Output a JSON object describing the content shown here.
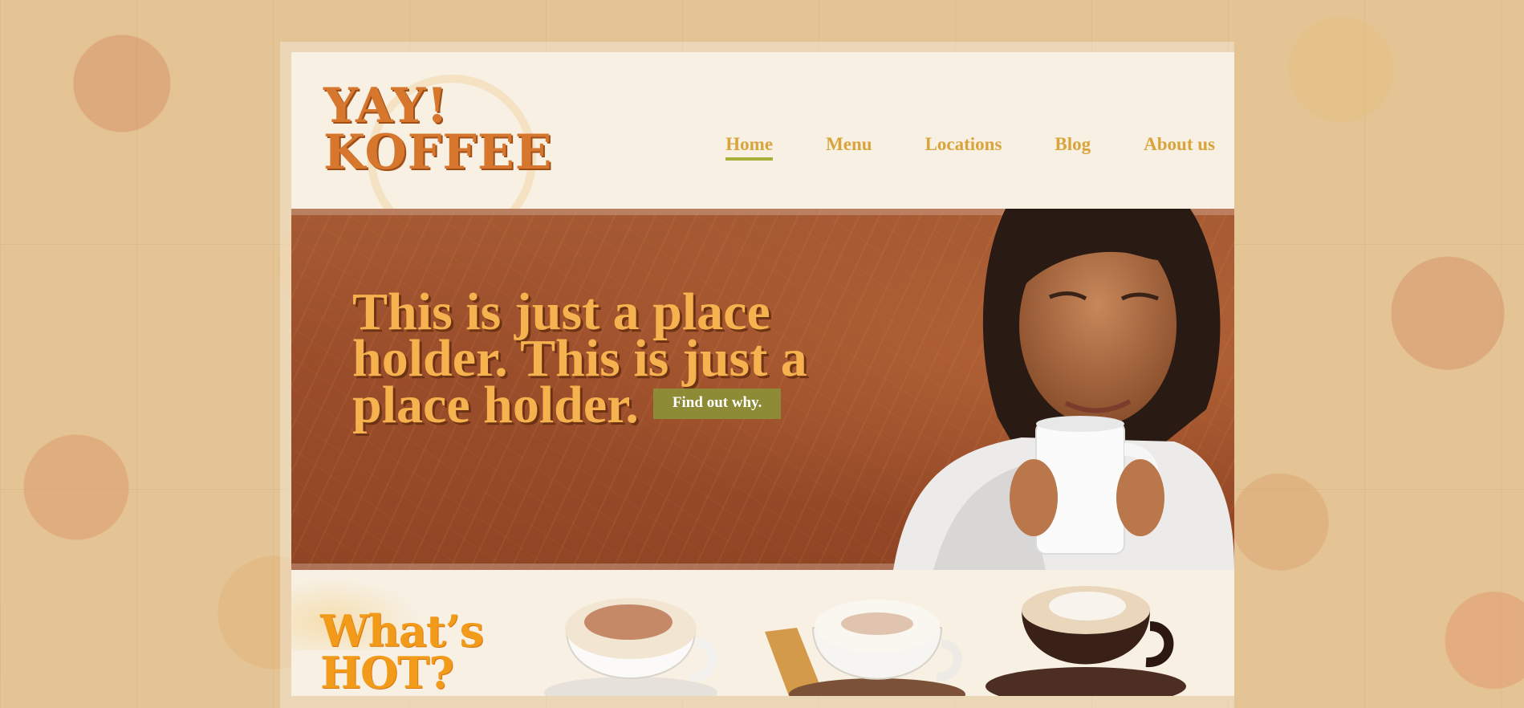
{
  "brand": {
    "logo_line1": "YAY!",
    "logo_line2": "KOFFEE"
  },
  "nav": {
    "items": [
      {
        "label": "Home",
        "active": true
      },
      {
        "label": "Menu",
        "active": false
      },
      {
        "label": "Locations",
        "active": false
      },
      {
        "label": "Blog",
        "active": false
      },
      {
        "label": "About us",
        "active": false
      }
    ]
  },
  "hero": {
    "headline": "This is just a place holder. This is just a place holder.",
    "cta_label": "Find out why."
  },
  "featured": {
    "heading_line1": "What’s",
    "heading_line2": "HOT?"
  },
  "colors": {
    "accent_orange": "#d7772e",
    "nav_gold": "#d9a43c",
    "nav_underline": "#a9b03a",
    "hero_brown": "#9c4e2b",
    "headline_gold": "#f5b24e",
    "cta_olive": "#8e8b37",
    "hot_orange": "#f29a1a"
  },
  "icons": [
    "coffee-cup-ring-icon"
  ]
}
